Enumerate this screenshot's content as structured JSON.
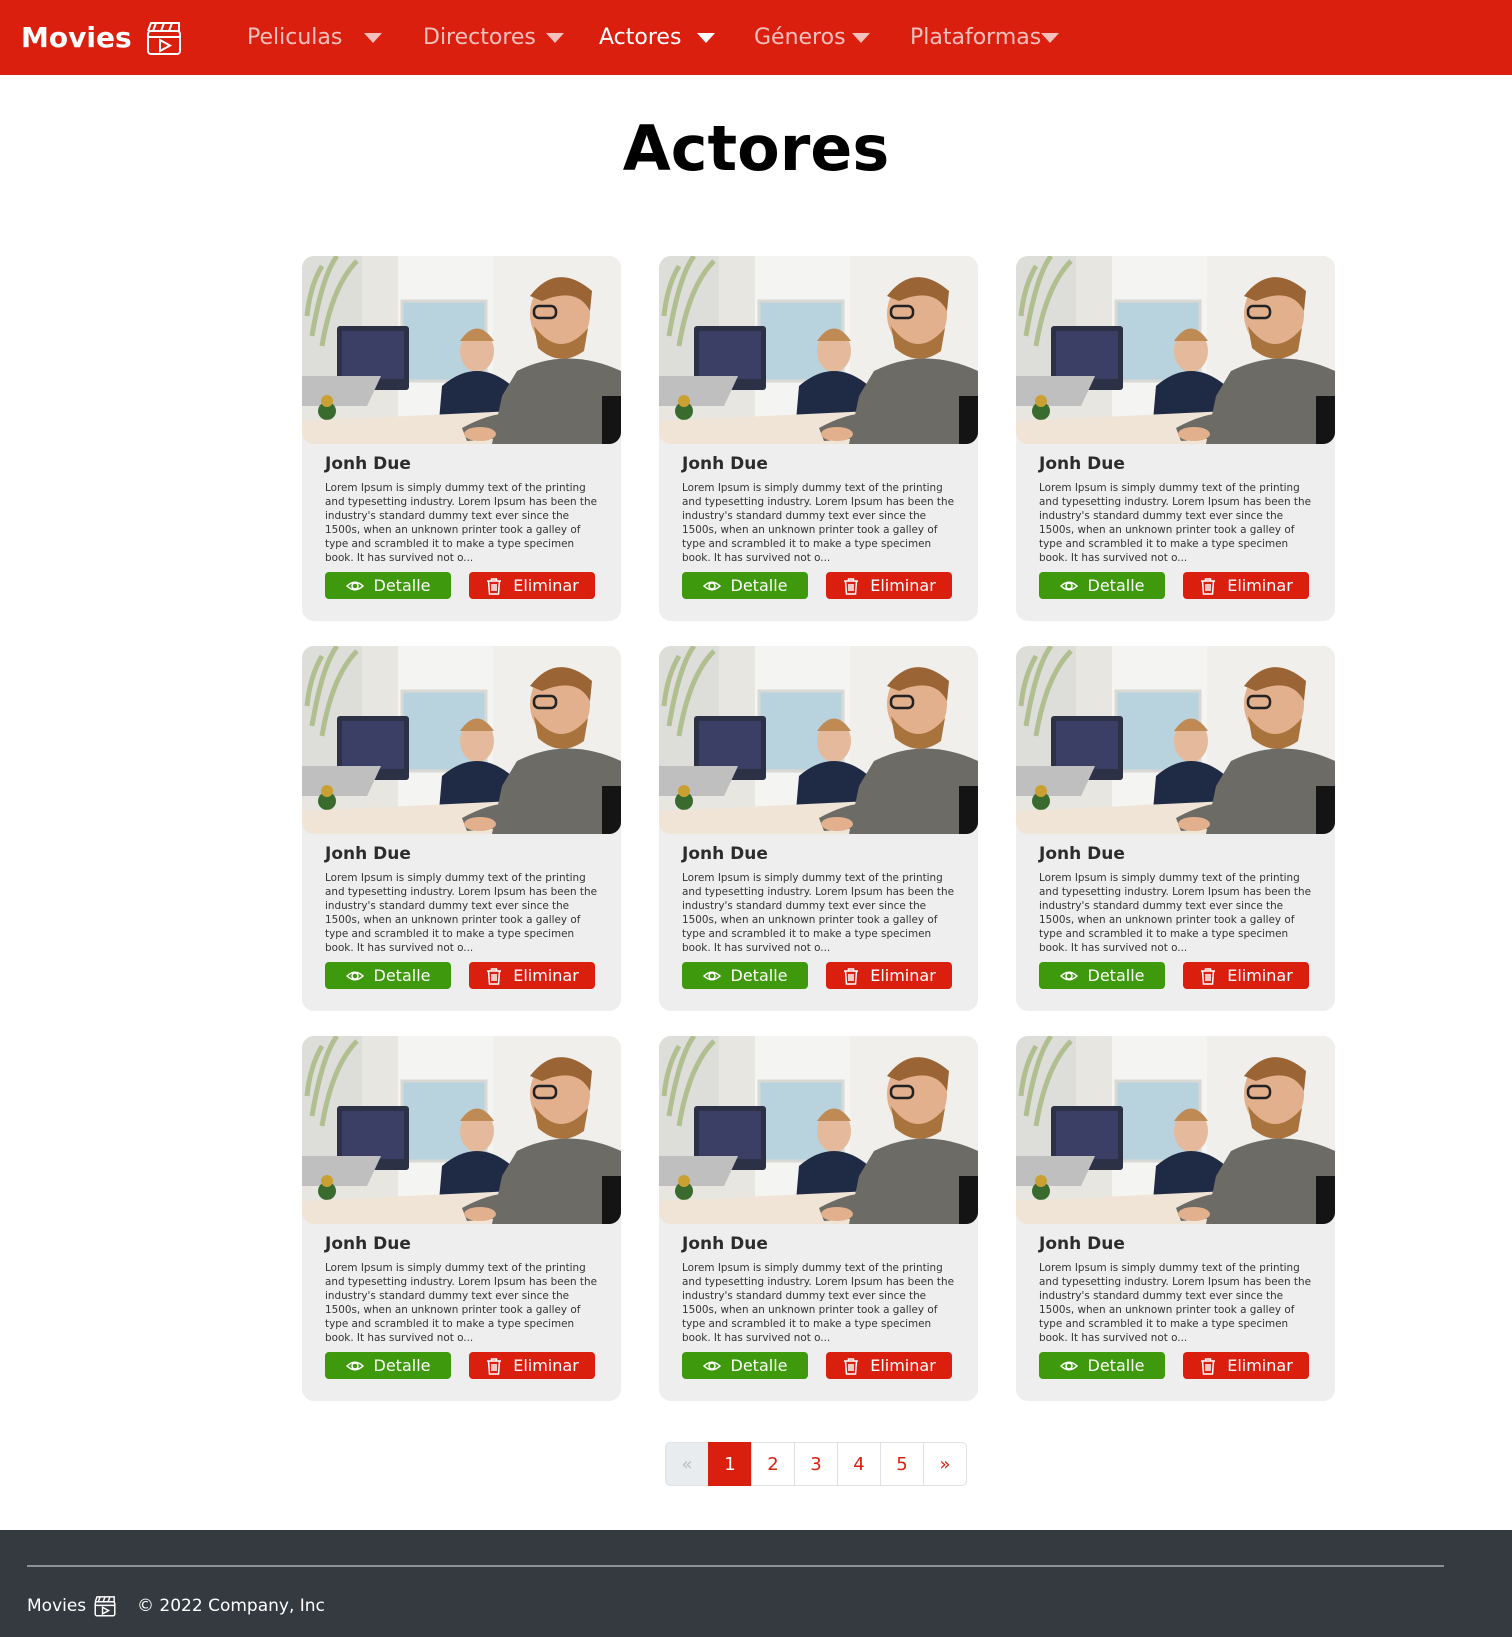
{
  "navbar": {
    "brand": "Movies",
    "brand_icon": "clapperboard-icon",
    "background": "#db1f0f",
    "items": [
      {
        "label": "Peliculas",
        "active": false
      },
      {
        "label": "Directores",
        "active": false
      },
      {
        "label": "Actores",
        "active": true
      },
      {
        "label": "Géneros",
        "active": false
      },
      {
        "label": "Plataformas",
        "active": false
      }
    ]
  },
  "page": {
    "title": "Actores"
  },
  "cards": [
    {
      "name": "Jonh Due",
      "text": "Lorem Ipsum is simply dummy text of the printing and typesetting industry. Lorem Ipsum has been the industry's standard dummy text ever since the 1500s, when an unknown printer took a galley of type and scrambled it to make a type specimen book. It has survived not o...",
      "detail_label": "Detalle",
      "delete_label": "Eliminar"
    },
    {
      "name": "Jonh Due",
      "text": "Lorem Ipsum is simply dummy text of the printing and typesetting industry. Lorem Ipsum has been the industry's standard dummy text ever since the 1500s, when an unknown printer took a galley of type and scrambled it to make a type specimen book. It has survived not o...",
      "detail_label": "Detalle",
      "delete_label": "Eliminar"
    },
    {
      "name": "Jonh Due",
      "text": "Lorem Ipsum is simply dummy text of the printing and typesetting industry. Lorem Ipsum has been the industry's standard dummy text ever since the 1500s, when an unknown printer took a galley of type and scrambled it to make a type specimen book. It has survived not o...",
      "detail_label": "Detalle",
      "delete_label": "Eliminar"
    },
    {
      "name": "Jonh Due",
      "text": "Lorem Ipsum is simply dummy text of the printing and typesetting industry. Lorem Ipsum has been the industry's standard dummy text ever since the 1500s, when an unknown printer took a galley of type and scrambled it to make a type specimen book. It has survived not o...",
      "detail_label": "Detalle",
      "delete_label": "Eliminar"
    },
    {
      "name": "Jonh Due",
      "text": "Lorem Ipsum is simply dummy text of the printing and typesetting industry. Lorem Ipsum has been the industry's standard dummy text ever since the 1500s, when an unknown printer took a galley of type and scrambled it to make a type specimen book. It has survived not o...",
      "detail_label": "Detalle",
      "delete_label": "Eliminar"
    },
    {
      "name": "Jonh Due",
      "text": "Lorem Ipsum is simply dummy text of the printing and typesetting industry. Lorem Ipsum has been the industry's standard dummy text ever since the 1500s, when an unknown printer took a galley of type and scrambled it to make a type specimen book. It has survived not o...",
      "detail_label": "Detalle",
      "delete_label": "Eliminar"
    },
    {
      "name": "Jonh Due",
      "text": "Lorem Ipsum is simply dummy text of the printing and typesetting industry. Lorem Ipsum has been the industry's standard dummy text ever since the 1500s, when an unknown printer took a galley of type and scrambled it to make a type specimen book. It has survived not o...",
      "detail_label": "Detalle",
      "delete_label": "Eliminar"
    },
    {
      "name": "Jonh Due",
      "text": "Lorem Ipsum is simply dummy text of the printing and typesetting industry. Lorem Ipsum has been the industry's standard dummy text ever since the 1500s, when an unknown printer took a galley of type and scrambled it to make a type specimen book. It has survived not o...",
      "detail_label": "Detalle",
      "delete_label": "Eliminar"
    },
    {
      "name": "Jonh Due",
      "text": "Lorem Ipsum is simply dummy text of the printing and typesetting industry. Lorem Ipsum has been the industry's standard dummy text ever since the 1500s, when an unknown printer took a galley of type and scrambled it to make a type specimen book. It has survived not o...",
      "detail_label": "Detalle",
      "delete_label": "Eliminar"
    }
  ],
  "pagination": {
    "prev": "«",
    "pages": [
      "1",
      "2",
      "3",
      "4",
      "5"
    ],
    "current": "1",
    "next": "»"
  },
  "footer": {
    "brand": "Movies",
    "copyright": "© 2022 Company, Inc"
  },
  "colors": {
    "accent": "#db1f0f",
    "detail_button": "#3e9a0c",
    "card_bg": "#eeeeee",
    "footer_bg": "#343a40"
  }
}
